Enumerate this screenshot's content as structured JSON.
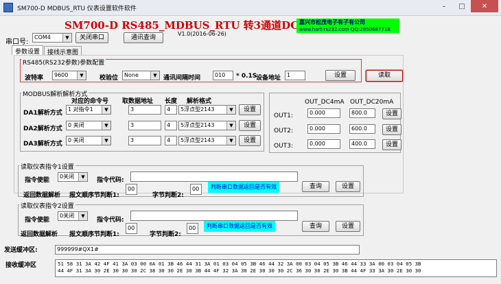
{
  "window": {
    "title": "SM700-D MDBUS_RTU 仪表设置软件软件"
  },
  "header": {
    "title": "SM700-D RS485_MDBUS_RTU 转3通道DC4-20MA",
    "version": "V1.0(2016-06-26)",
    "company_line1": "嘉兴市松茂电子有子有公司",
    "company_line2": "www.hart-rs232.com QQ:2850687718"
  },
  "port": {
    "label": "串口号:",
    "value": "COM4",
    "close_btn": "关闭串口",
    "query_btn": "通讯查询"
  },
  "tabs": [
    "参数设置",
    "接线示意图"
  ],
  "rs485": {
    "group_title": "RS485(RS232参数)参数配置",
    "baud_label": "波特率",
    "baud_value": "9600",
    "parity_label": "校验位",
    "parity_value": "None",
    "interval_label": "通讯间隔时间",
    "interval_value": "010",
    "interval_unit": "* 0.1S",
    "addr_label": "设备地址",
    "addr_value": "1",
    "set_btn": "设置",
    "read_btn": "读取"
  },
  "modbus": {
    "group_title": "MODBUS解析解析方式",
    "headers": {
      "cmd": "对应的命令号",
      "addr": "取数据地址",
      "len": "长度",
      "fmt": "解析格式"
    },
    "rows": [
      {
        "label": "DA1解析方式",
        "cmd": "1 对指令1",
        "addr": "3",
        "len": "4",
        "fmt": "5浮点型2143",
        "btn": "设置"
      },
      {
        "label": "DA2解析方式",
        "cmd": "0 关闭",
        "addr": "3",
        "len": "4",
        "fmt": "5浮点型2143",
        "btn": "设置"
      },
      {
        "label": "DA3解析方式",
        "cmd": "0 关闭",
        "addr": "3",
        "len": "4",
        "fmt": "5浮点型2143",
        "btn": "设置"
      }
    ]
  },
  "outputs": {
    "col1": "OUT_DC4mA",
    "col2": "OUT_DC20mA",
    "rows": [
      {
        "label": "OUT1:",
        "v4": "0.000",
        "v20": "800.0",
        "btn": "设置"
      },
      {
        "label": "OUT2:",
        "v4": "0.000",
        "v20": "600.0",
        "btn": "设置"
      },
      {
        "label": "OUT3:",
        "v4": "0.000",
        "v20": "400.0",
        "btn": "设置"
      }
    ]
  },
  "cmd1": {
    "group_title": "读取仪表指令1设置",
    "enable_label": "指令使能",
    "enable_value": "0关闭",
    "code_label": "指令代码:",
    "code_value": "",
    "parse_label": "返回数据解析",
    "order1_label": "报文顺序节判断1:",
    "order1_value": "00",
    "order2_label": "字节判断2:",
    "order2_value": "00",
    "note": "判断串口数据返回是否有效",
    "query_btn": "查询",
    "set_btn": "设置"
  },
  "cmd2": {
    "group_title": "读取仪表指令2设置",
    "enable_label": "指令使能",
    "enable_value": "0关闭",
    "code_label": "指令代码:",
    "code_value": "",
    "parse_label": "返回数据解析",
    "order1_label": "报文顺序节判断1:",
    "order1_value": "00",
    "order2_label": "字节判断2:",
    "order2_value": "00",
    "note": "判断串口数据返回是否有效",
    "query_btn": "查询",
    "set_btn": "设置"
  },
  "send": {
    "label": "发送缓冲区:",
    "value": "999999#QX1#"
  },
  "recv": {
    "label": "接收缓冲区",
    "line1": "51 58 31 3A 42 4F 41 3A 03 00 0A 01 3B 46 44 31 3A 01 03 04 05 3B 46 44 32 3A 00 03 04 05 3B 46 44 33 3A 00 03 04 05 3B",
    "line2": "44 4F 31 3A 30 2E 30 30 30 2C 38 30 30 2E 30 3B 44 4F 32 3A 30 2E 30 30 30 2C 36 30 30 2E 30 3B 44 4F 33 3A 30 2E 30 30"
  }
}
